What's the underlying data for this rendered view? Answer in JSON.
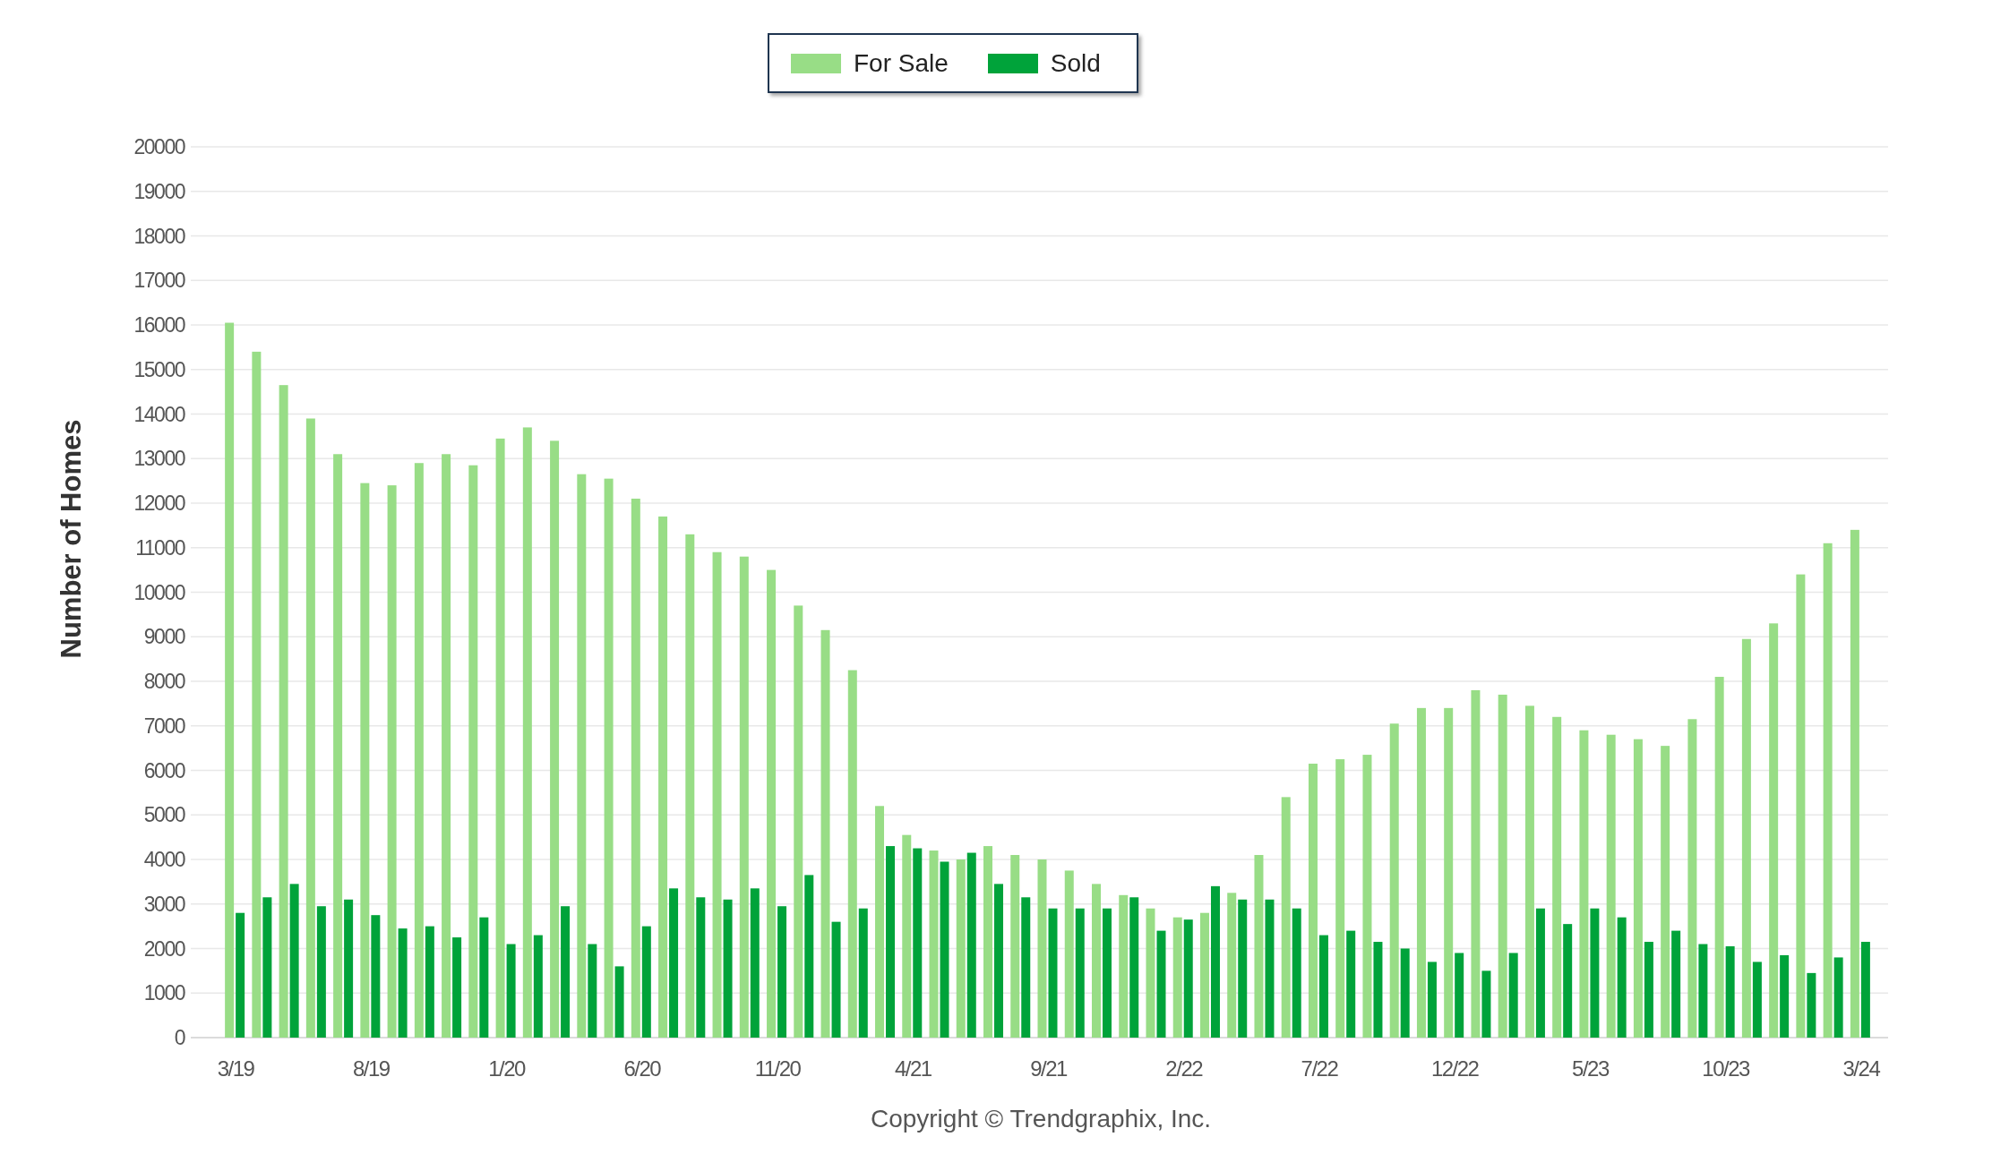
{
  "chart": {
    "chart_data": {
      "type": "bar",
      "ylabel": "Number of Homes",
      "categories": [
        "3/19",
        null,
        null,
        null,
        null,
        "8/19",
        null,
        null,
        null,
        null,
        "1/20",
        null,
        null,
        null,
        null,
        "6/20",
        null,
        null,
        null,
        null,
        "11/20",
        null,
        null,
        null,
        null,
        "4/21",
        null,
        null,
        null,
        null,
        "9/21",
        null,
        null,
        null,
        null,
        "2/22",
        null,
        null,
        null,
        null,
        "7/22",
        null,
        null,
        null,
        null,
        "12/22",
        null,
        null,
        null,
        null,
        "5/23",
        null,
        null,
        null,
        null,
        "10/23",
        null,
        null,
        null,
        null,
        "3/24"
      ],
      "series": [
        {
          "name": "For Sale",
          "color": "#98dd86",
          "values": [
            16050,
            15400,
            14650,
            13900,
            13100,
            12450,
            12400,
            12900,
            13100,
            12850,
            13450,
            13700,
            13400,
            12650,
            12550,
            12100,
            11700,
            11300,
            10900,
            10800,
            10500,
            9700,
            9150,
            8250,
            5200,
            4550,
            4200,
            4000,
            4300,
            4100,
            4000,
            3750,
            3450,
            3200,
            2900,
            2700,
            2800,
            3250,
            4100,
            5400,
            6150,
            6250,
            6350,
            7050,
            7400,
            7400,
            7800,
            7700,
            7450,
            7200,
            6900,
            6800,
            6700,
            6550,
            7150,
            8100,
            8950,
            9300,
            10400,
            11100,
            11400
          ]
        },
        {
          "name": "Sold",
          "color": "#00a33a",
          "values": [
            2800,
            3150,
            3450,
            2950,
            3100,
            2750,
            2450,
            2500,
            2250,
            2700,
            2100,
            2300,
            2950,
            2100,
            1600,
            2500,
            3350,
            3150,
            3100,
            3350,
            2950,
            3650,
            2600,
            2900,
            4300,
            4250,
            3950,
            4150,
            3450,
            3150,
            2900,
            2900,
            2900,
            3150,
            2400,
            2650,
            3400,
            3100,
            3100,
            2900,
            2300,
            2400,
            2150,
            2000,
            1700,
            1900,
            1500,
            1900,
            2900,
            2550,
            2900,
            2700,
            2150,
            2400,
            2100,
            2050,
            1700,
            1850,
            1450,
            1800,
            2150
          ]
        }
      ],
      "ylim": [
        0,
        20000
      ],
      "grid": true,
      "yticks": [
        0,
        1000,
        2000,
        3000,
        4000,
        5000,
        6000,
        7000,
        8000,
        9000,
        10000,
        11000,
        12000,
        13000,
        14000,
        15000,
        16000,
        17000,
        18000,
        19000,
        20000
      ]
    }
  },
  "footer": {
    "copyright": "Copyright © Trendgraphix, Inc."
  }
}
